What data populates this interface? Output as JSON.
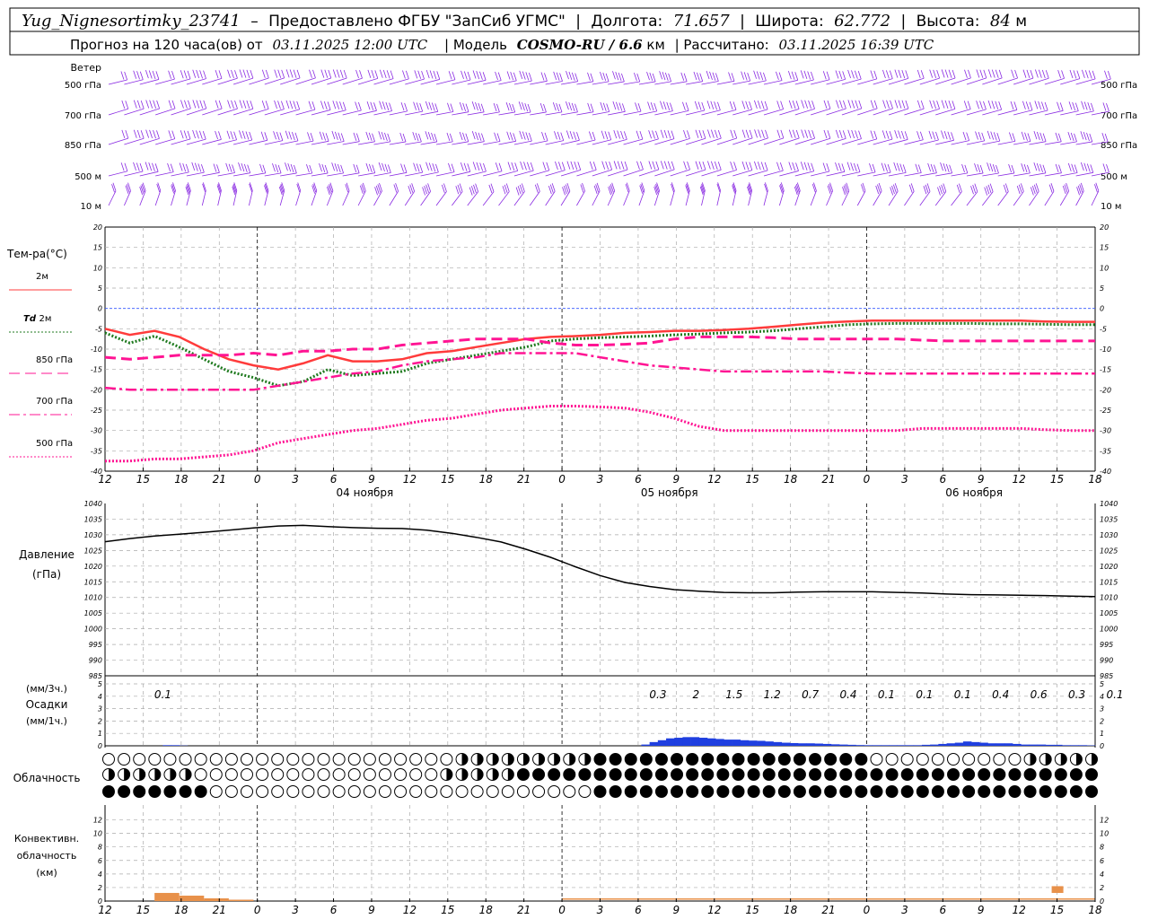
{
  "header": {
    "station": "Yug_Nignesortimky_23741",
    "dash": "–",
    "provider": "Предоставлено ФГБУ \"ЗапСиб УГМС\"",
    "lon_label": "Долгота:",
    "lon": "71.657",
    "lat_label": "Широта:",
    "lat": "62.772",
    "alt_label": "Высота:",
    "alt": "84",
    "alt_unit": "м",
    "forecast_label": "Прогноз на 120 часа(ов) от",
    "forecast_base": "03.11.2025 12:00 UTC",
    "model_label": "| Модель",
    "model": "COSMO-RU / 6.6",
    "model_unit": "км",
    "calc_label": "| Рассчитано:",
    "calc_time": "03.11.2025 16:39 UTC"
  },
  "time_axis": {
    "ticks": [
      "12",
      "15",
      "18",
      "21",
      "0",
      "3",
      "6",
      "9",
      "12",
      "15",
      "18",
      "21",
      "0",
      "3",
      "6",
      "9",
      "12",
      "15",
      "18",
      "21",
      "0",
      "3",
      "6",
      "9",
      "12",
      "15",
      "18"
    ],
    "dates": [
      {
        "label": "04 ноября",
        "tick": 8
      },
      {
        "label": "05 ноября",
        "tick": 16
      },
      {
        "label": "06 ноября",
        "tick": 24
      }
    ]
  },
  "wind_panel": {
    "title": "Ветер",
    "levels": [
      "500 гПа",
      "700 гПа",
      "850 гПа",
      "500 м",
      "10 м"
    ],
    "color": "#8a2be2"
  },
  "temperature_panel": {
    "title": "Тем-ра(°C)",
    "legend": [
      {
        "label": "2м",
        "italic_prefix": "",
        "color": "#ff3b3b",
        "style": "solid"
      },
      {
        "label": "2м",
        "italic_prefix": "Td",
        "color": "#1f7a1f",
        "style": "dotted"
      },
      {
        "label": "850 гПа",
        "italic_prefix": "",
        "color": "#ff1493",
        "style": "dashed"
      },
      {
        "label": "700 гПа",
        "italic_prefix": "",
        "color": "#ff1493",
        "style": "dashdot"
      },
      {
        "label": "500 гПа",
        "italic_prefix": "",
        "color": "#ff1493",
        "style": "dotted"
      }
    ]
  },
  "pressure_panel": {
    "label1": "Давление",
    "label2": "(гПа)"
  },
  "precip_panel": {
    "label1": "(мм/3ч.)",
    "label2": "Осадки",
    "label3": "(мм/1ч.)",
    "amounts": [
      {
        "tick": 1,
        "value": "0.1"
      },
      {
        "tick": 14,
        "value": "0.3"
      },
      {
        "tick": 15,
        "value": "2"
      },
      {
        "tick": 16,
        "value": "1.5"
      },
      {
        "tick": 17,
        "value": "1.2"
      },
      {
        "tick": 18,
        "value": "0.7"
      },
      {
        "tick": 19,
        "value": "0.4"
      },
      {
        "tick": 20,
        "value": "0.1"
      },
      {
        "tick": 21,
        "value": "0.1"
      },
      {
        "tick": 22,
        "value": "0.1"
      },
      {
        "tick": 23,
        "value": "0.4"
      },
      {
        "tick": 24,
        "value": "0.6"
      },
      {
        "tick": 25,
        "value": "0.3"
      },
      {
        "tick": 26,
        "value": "0.1"
      }
    ],
    "color": "#1f3fe0"
  },
  "cloud_panel": {
    "label": "Облачность"
  },
  "convective_panel": {
    "label1": "Конвективн.",
    "label2": "облачность",
    "label3": "(км)",
    "color": "#e8914a"
  },
  "chart_data": [
    {
      "type": "line",
      "title": "Тем-ра(°C)",
      "xlabel": "",
      "ylabel": "",
      "ylim": [
        -40,
        20
      ],
      "yticks": [
        20,
        15,
        10,
        5,
        0,
        -5,
        -10,
        -15,
        -20,
        -25,
        -30,
        -35,
        -40
      ],
      "x": [
        0,
        3,
        6,
        9,
        12,
        15,
        18,
        21,
        24,
        27,
        30,
        33,
        36,
        39,
        42,
        45,
        48,
        51,
        54,
        57,
        60,
        63,
        66,
        69,
        72,
        75,
        78,
        81,
        84,
        87,
        90,
        93,
        96,
        99,
        102,
        105,
        108,
        111,
        114,
        117,
        120
      ],
      "series": [
        {
          "name": "2м",
          "values": [
            -5,
            -6.5,
            -5.5,
            -7,
            -10,
            -12.5,
            -14,
            -15,
            -13.5,
            -11.5,
            -13,
            -13,
            -12.5,
            -11,
            -10.5,
            -9.5,
            -8.5,
            -7.5,
            -7,
            -6.8,
            -6.5,
            -6,
            -5.8,
            -5.5,
            -5.5,
            -5.3,
            -5,
            -4.5,
            -4,
            -3.5,
            -3.2,
            -3,
            -3,
            -3,
            -3,
            -3,
            -3,
            -3,
            -3.2,
            -3.3,
            -3.3
          ]
        },
        {
          "name": "Td 2м",
          "values": [
            -6,
            -8.5,
            -6.8,
            -9.5,
            -12.5,
            -15.5,
            -17,
            -19,
            -18,
            -15,
            -16.5,
            -16,
            -15.5,
            -13.5,
            -12.5,
            -11.5,
            -10.5,
            -9.5,
            -8,
            -7.5,
            -7.2,
            -7,
            -6.8,
            -6.5,
            -6.3,
            -6,
            -5.8,
            -5.5,
            -5,
            -4.5,
            -4,
            -3.8,
            -3.7,
            -3.7,
            -3.7,
            -3.7,
            -3.8,
            -3.8,
            -3.9,
            -4,
            -4
          ]
        },
        {
          "name": "850 гПа",
          "values": [
            -12,
            -12.5,
            -12,
            -11.5,
            -11.5,
            -11.5,
            -11,
            -11.5,
            -10.5,
            -10.5,
            -10,
            -10,
            -9,
            -8.5,
            -8,
            -7.5,
            -7.5,
            -7.5,
            -8.5,
            -9,
            -9,
            -8.8,
            -8.5,
            -7.5,
            -7,
            -7,
            -7,
            -7.2,
            -7.5,
            -7.5,
            -7.5,
            -7.5,
            -7.5,
            -7.8,
            -8,
            -8,
            -8,
            -8,
            -8,
            -8,
            -8
          ]
        },
        {
          "name": "700 гПа",
          "values": [
            -19.5,
            -20,
            -20,
            -20,
            -20,
            -20,
            -20,
            -19,
            -18,
            -17,
            -16,
            -15.5,
            -14,
            -13,
            -12.5,
            -12,
            -11,
            -11,
            -11,
            -11,
            -12,
            -13,
            -14,
            -14.5,
            -15,
            -15.5,
            -15.5,
            -15.5,
            -15.5,
            -15.5,
            -15.8,
            -16,
            -16,
            -16,
            -16,
            -16,
            -16,
            -16,
            -16,
            -16,
            -16
          ]
        },
        {
          "name": "500 гПа",
          "values": [
            -37.5,
            -37.5,
            -37,
            -37,
            -36.5,
            -36,
            -35,
            -33,
            -32,
            -31,
            -30,
            -29.5,
            -28.5,
            -27.5,
            -27,
            -26,
            -25,
            -24.5,
            -24,
            -24,
            -24.2,
            -24.5,
            -25.5,
            -27,
            -29,
            -30,
            -30,
            -30,
            -30,
            -30,
            -30,
            -30,
            -30,
            -29.5,
            -29.5,
            -29.5,
            -29.5,
            -29.5,
            -29.8,
            -30,
            -30
          ]
        }
      ]
    },
    {
      "type": "line",
      "title": "Давление (гПа)",
      "ylim": [
        985,
        1040
      ],
      "yticks": [
        1040,
        1035,
        1030,
        1025,
        1020,
        1015,
        1010,
        1005,
        1000,
        995,
        990,
        985
      ],
      "x": [
        0,
        3,
        6,
        9,
        12,
        15,
        18,
        21,
        24,
        27,
        30,
        33,
        36,
        39,
        42,
        45,
        48,
        51,
        54,
        57,
        60,
        63,
        66,
        69,
        72,
        75,
        78,
        81,
        84,
        87,
        90,
        93,
        96,
        99,
        102,
        105,
        108,
        111,
        114,
        117,
        120
      ],
      "series": [
        {
          "name": "Давление",
          "values": [
            1027.8,
            1028.8,
            1029.6,
            1030.2,
            1030.8,
            1031.5,
            1032.2,
            1032.8,
            1033,
            1032.6,
            1032.3,
            1032.1,
            1032,
            1031.5,
            1030.5,
            1029.2,
            1027.7,
            1025.4,
            1022.8,
            1019.8,
            1017,
            1014.8,
            1013.5,
            1012.5,
            1012,
            1011.6,
            1011.5,
            1011.5,
            1011.7,
            1011.8,
            1011.8,
            1011.8,
            1011.6,
            1011.4,
            1011.1,
            1010.9,
            1010.8,
            1010.7,
            1010.6,
            1010.4,
            1010.3
          ]
        }
      ]
    },
    {
      "type": "bar",
      "title": "Осадки (мм/3ч., мм/1ч.)",
      "ylim": [
        0,
        5
      ],
      "yticks": [
        5,
        4,
        3,
        2,
        1,
        0
      ],
      "x": [
        5,
        6,
        7,
        8,
        9,
        10,
        11,
        12,
        13,
        14,
        15,
        16,
        17,
        18,
        19,
        20,
        21,
        22,
        23,
        24,
        25,
        26,
        27,
        28,
        29,
        30,
        31,
        32,
        33,
        34,
        35,
        36,
        37,
        38,
        39,
        40,
        41,
        42,
        43,
        44,
        45,
        46,
        47,
        48,
        49,
        50,
        51,
        52,
        53,
        54,
        55,
        56,
        57,
        58,
        59,
        60,
        61,
        62,
        63,
        64,
        65,
        66,
        67,
        68,
        69,
        70,
        71,
        72,
        73,
        74,
        75,
        76,
        77,
        78,
        79,
        80,
        81,
        82,
        83,
        84,
        85,
        86,
        87,
        88,
        89,
        90,
        91,
        92,
        93,
        94,
        95,
        96,
        97,
        98,
        99,
        100,
        101,
        102,
        103,
        104,
        105,
        106,
        107,
        108,
        109,
        110,
        111,
        112,
        113,
        114,
        115,
        116,
        117,
        118,
        119,
        120
      ],
      "series": [
        {
          "name": "мм/1ч.",
          "values": [
            0,
            0,
            0,
            0.05,
            0.05,
            0.02,
            0,
            0,
            0,
            0,
            0,
            0,
            0,
            0,
            0,
            0,
            0,
            0,
            0,
            0,
            0,
            0,
            0,
            0,
            0,
            0,
            0,
            0,
            0,
            0,
            0,
            0,
            0,
            0,
            0,
            0,
            0,
            0,
            0,
            0,
            0,
            0,
            0,
            0,
            0,
            0,
            0,
            0,
            0,
            0,
            0,
            0,
            0,
            0,
            0,
            0,
            0,
            0,
            0,
            0,
            0,
            0.1,
            0.3,
            0.45,
            0.6,
            0.65,
            0.7,
            0.7,
            0.65,
            0.6,
            0.55,
            0.5,
            0.5,
            0.45,
            0.42,
            0.4,
            0.35,
            0.3,
            0.25,
            0.22,
            0.2,
            0.2,
            0.18,
            0.15,
            0.12,
            0.1,
            0.08,
            0.06,
            0.05,
            0.05,
            0.05,
            0.05,
            0.05,
            0.05,
            0.05,
            0.08,
            0.1,
            0.15,
            0.2,
            0.25,
            0.35,
            0.3,
            0.25,
            0.2,
            0.2,
            0.2,
            0.15,
            0.1,
            0.1,
            0.1,
            0.08,
            0.08,
            0.05,
            0.05,
            0.05,
            0.03
          ]
        }
      ]
    },
    {
      "type": "bar",
      "title": "Конвективн. облачность (км)",
      "ylim": [
        0,
        13
      ],
      "yticks": [
        12,
        10,
        8,
        6,
        4,
        2,
        0
      ],
      "x": [
        0,
        3,
        6,
        9,
        12,
        15,
        18,
        21,
        24,
        27,
        30,
        33,
        36,
        39,
        42,
        45,
        48,
        51,
        54,
        57,
        60,
        63,
        66,
        69,
        72,
        75,
        78,
        81,
        84,
        87,
        90,
        93,
        96,
        99,
        102,
        105,
        108,
        111,
        114,
        117,
        120
      ],
      "series": [
        {
          "name": "Конвективн. облачность",
          "values": [
            0,
            0,
            1.2,
            0.8,
            0.4,
            0.2,
            0,
            0,
            0,
            0,
            0,
            0,
            0,
            0,
            0,
            0,
            0,
            0,
            0,
            0,
            0,
            0,
            0,
            0,
            0,
            0,
            0,
            0,
            0,
            0,
            0,
            0,
            0,
            0,
            0,
            0,
            0,
            0,
            0,
            0,
            0
          ]
        }
      ]
    }
  ]
}
